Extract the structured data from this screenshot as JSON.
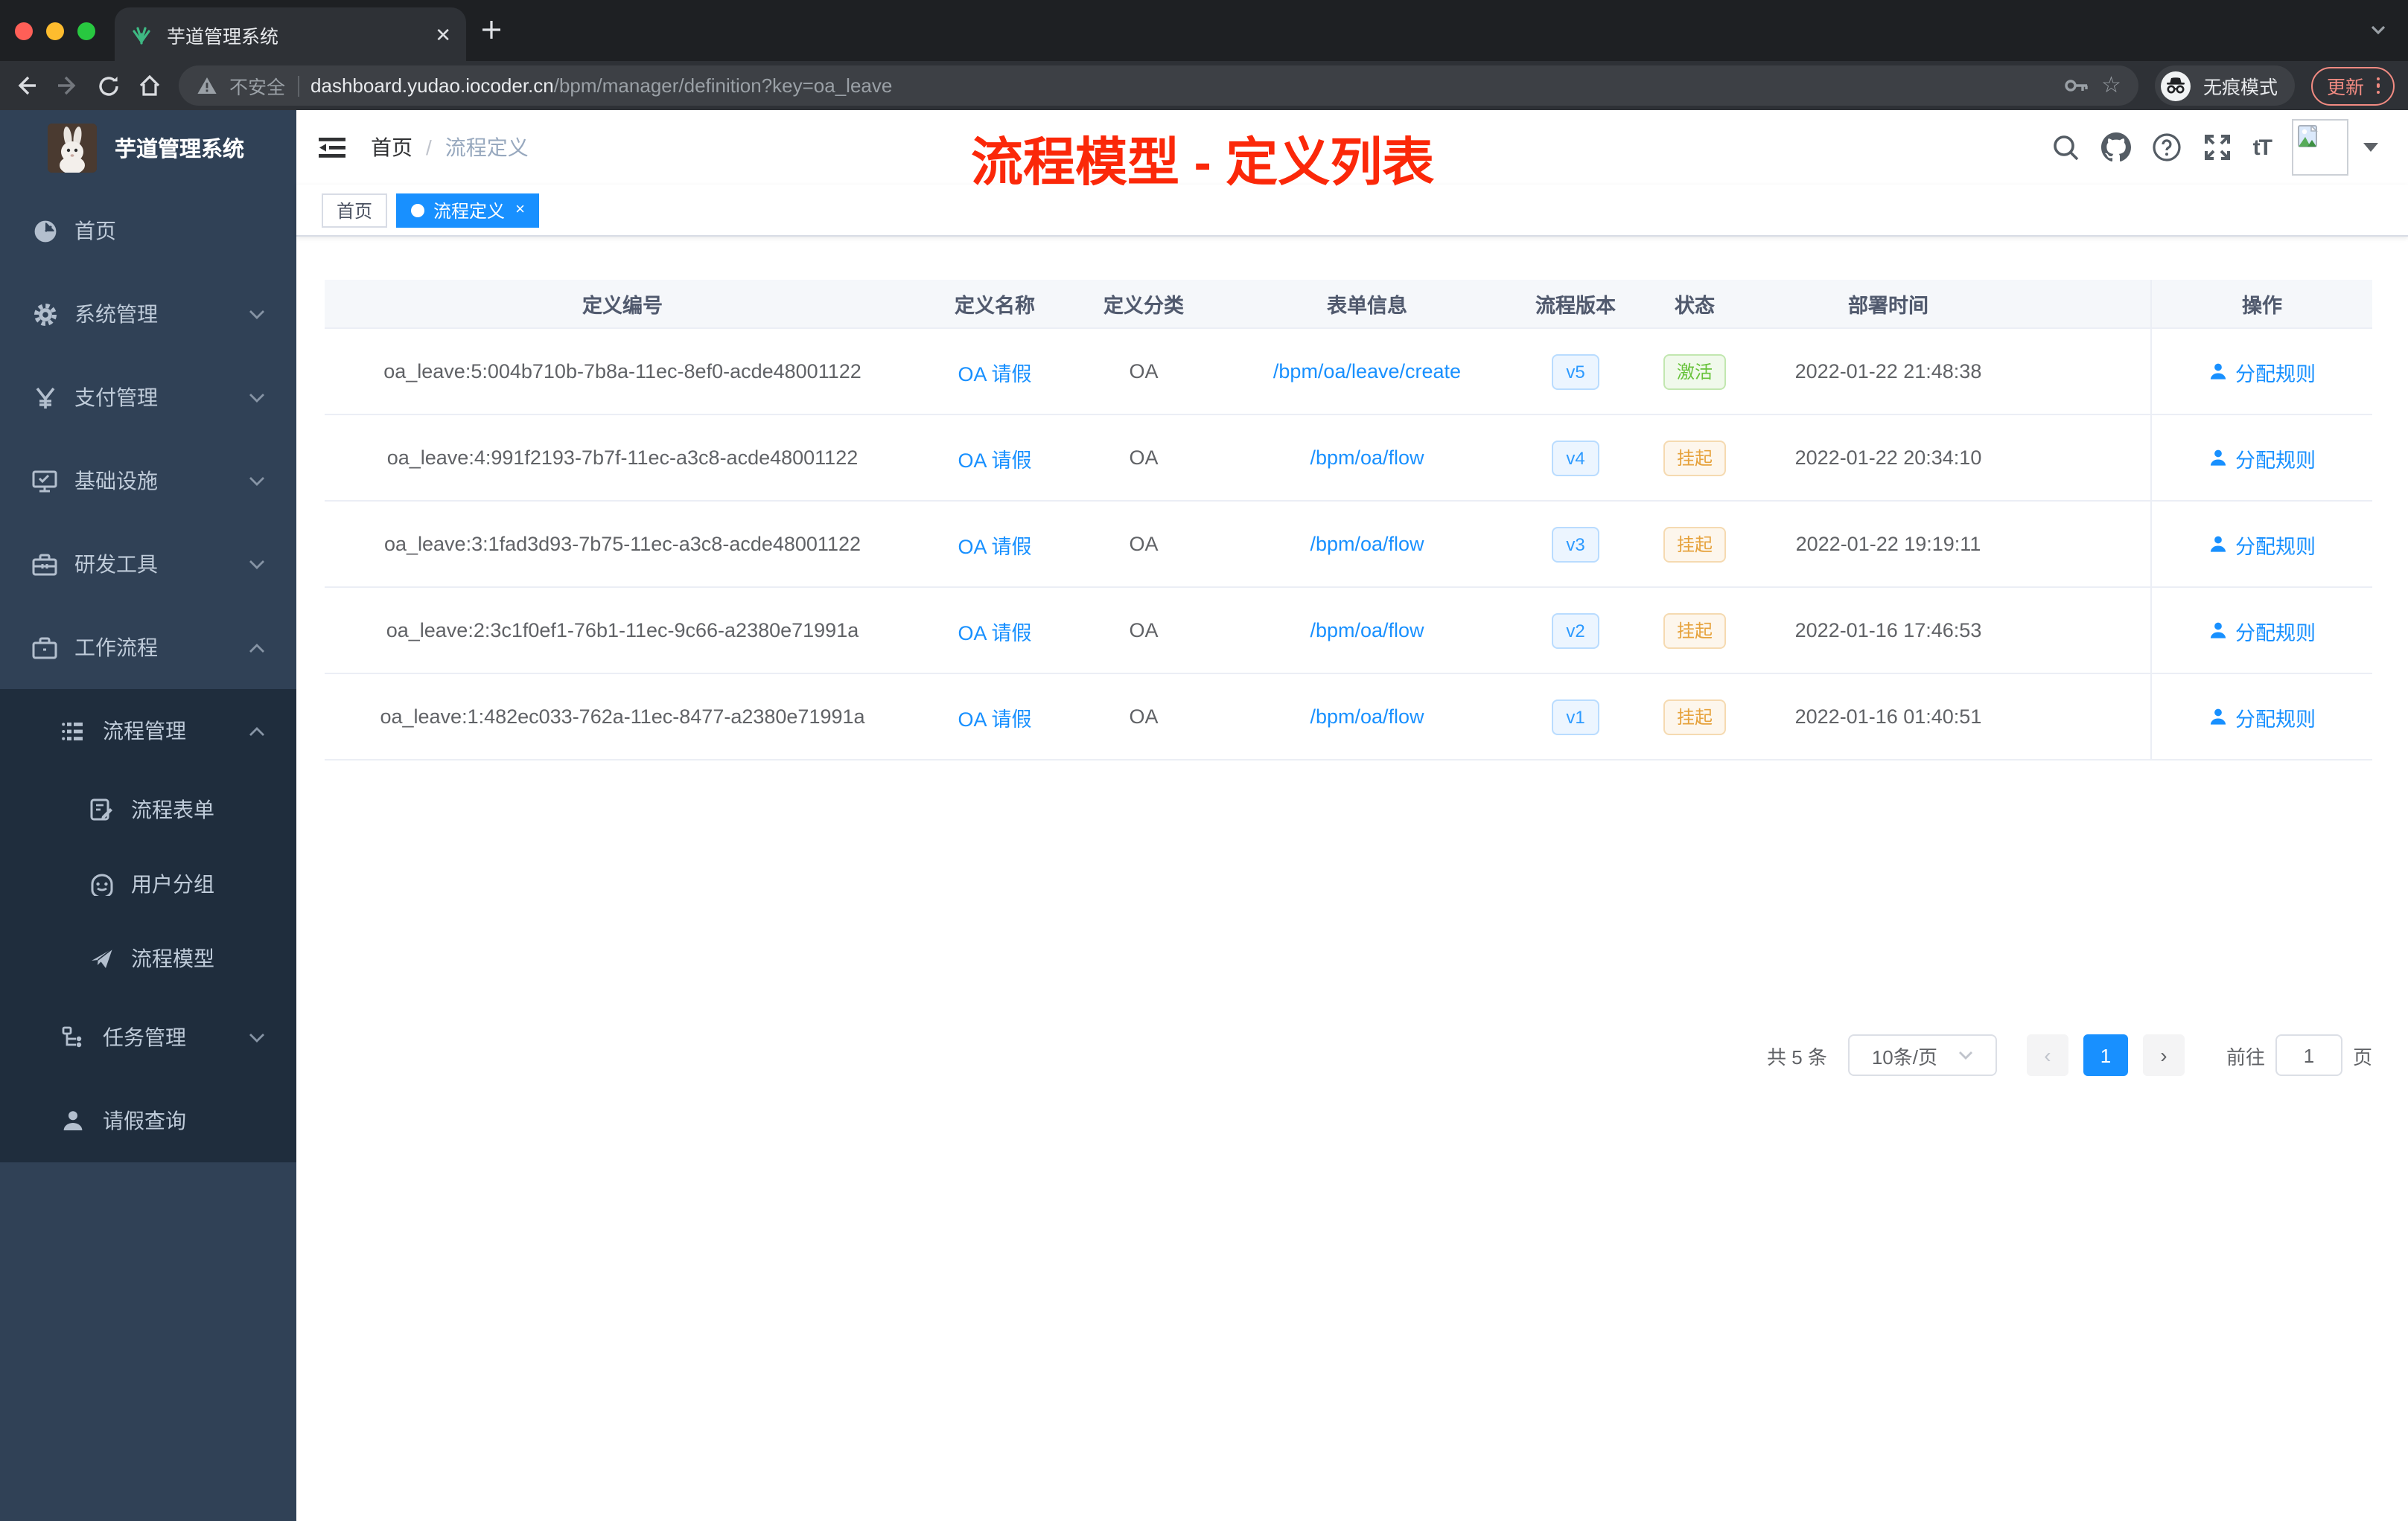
{
  "browser": {
    "tab_title": "芋道管理系统",
    "security_label": "不安全",
    "url_host": "dashboard.yudao.iocoder.cn",
    "url_path": "/bpm/manager/definition?key=oa_leave",
    "incognito_label": "无痕模式",
    "update_label": "更新"
  },
  "sidebar": {
    "logo_title": "芋道管理系统",
    "items": [
      {
        "label": "首页",
        "icon": "dashboard-icon",
        "level": 1
      },
      {
        "label": "系统管理",
        "icon": "gear-icon",
        "level": 1,
        "chevron": "down"
      },
      {
        "label": "支付管理",
        "icon": "yen-icon",
        "level": 1,
        "chevron": "down"
      },
      {
        "label": "基础设施",
        "icon": "monitor-icon",
        "level": 1,
        "chevron": "down"
      },
      {
        "label": "研发工具",
        "icon": "toolbox-icon",
        "level": 1,
        "chevron": "down"
      },
      {
        "label": "工作流程",
        "icon": "briefcase-icon",
        "level": 1,
        "chevron": "up"
      },
      {
        "label": "流程管理",
        "icon": "list-icon",
        "level": 2,
        "chevron": "up"
      },
      {
        "label": "流程表单",
        "icon": "form-icon",
        "level": 3
      },
      {
        "label": "用户分组",
        "icon": "user-group-icon",
        "level": 3
      },
      {
        "label": "流程模型",
        "icon": "paper-plane-icon",
        "level": 3
      },
      {
        "label": "任务管理",
        "icon": "tree-icon",
        "level": 2,
        "chevron": "down"
      },
      {
        "label": "请假查询",
        "icon": "person-icon",
        "level": 2
      }
    ]
  },
  "header": {
    "breadcrumb_home": "首页",
    "breadcrumb_sep": "/",
    "breadcrumb_current": "流程定义",
    "annotation": "流程模型 - 定义列表"
  },
  "tags": {
    "home": "首页",
    "active": "流程定义",
    "close": "×"
  },
  "table": {
    "columns": [
      "定义编号",
      "定义名称",
      "定义分类",
      "表单信息",
      "流程版本",
      "状态",
      "部署时间",
      "操作"
    ],
    "rows": [
      {
        "id": "oa_leave:5:004b710b-7b8a-11ec-8ef0-acde48001122",
        "name": "OA 请假",
        "category": "OA",
        "form": "/bpm/oa/leave/create",
        "version": "v5",
        "status": "激活",
        "status_type": "success",
        "deploy_time": "2022-01-22 21:48:38",
        "action": "分配规则"
      },
      {
        "id": "oa_leave:4:991f2193-7b7f-11ec-a3c8-acde48001122",
        "name": "OA 请假",
        "category": "OA",
        "form": "/bpm/oa/flow",
        "version": "v4",
        "status": "挂起",
        "status_type": "warning",
        "deploy_time": "2022-01-22 20:34:10",
        "action": "分配规则"
      },
      {
        "id": "oa_leave:3:1fad3d93-7b75-11ec-a3c8-acde48001122",
        "name": "OA 请假",
        "category": "OA",
        "form": "/bpm/oa/flow",
        "version": "v3",
        "status": "挂起",
        "status_type": "warning",
        "deploy_time": "2022-01-22 19:19:11",
        "action": "分配规则"
      },
      {
        "id": "oa_leave:2:3c1f0ef1-76b1-11ec-9c66-a2380e71991a",
        "name": "OA 请假",
        "category": "OA",
        "form": "/bpm/oa/flow",
        "version": "v2",
        "status": "挂起",
        "status_type": "warning",
        "deploy_time": "2022-01-16 17:46:53",
        "action": "分配规则"
      },
      {
        "id": "oa_leave:1:482ec033-762a-11ec-8477-a2380e71991a",
        "name": "OA 请假",
        "category": "OA",
        "form": "/bpm/oa/flow",
        "version": "v1",
        "status": "挂起",
        "status_type": "warning",
        "deploy_time": "2022-01-16 01:40:51",
        "action": "分配规则"
      }
    ]
  },
  "pagination": {
    "total": "共 5 条",
    "page_size": "10条/页",
    "prev": "‹",
    "next": "›",
    "current_page": "1",
    "goto_label": "前往",
    "goto_value": "1",
    "goto_unit": "页"
  },
  "colors": {
    "accent": "#1890ff",
    "sidebar_bg": "#304156",
    "submenu_bg": "#1f2d3d",
    "success": "#67c23a",
    "warning": "#e6a23c",
    "annotation_red": "#fb2809"
  }
}
